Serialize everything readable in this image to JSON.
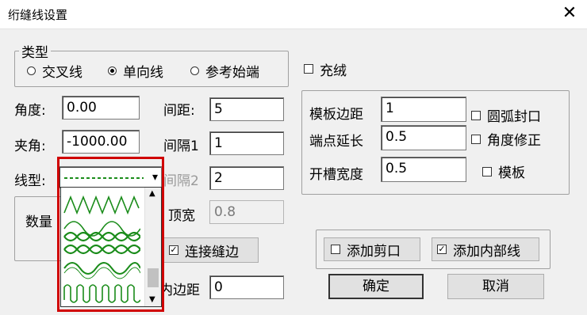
{
  "window": {
    "title": "绗缝线设置",
    "close_symbol": "✕"
  },
  "type_group": {
    "label": "类型",
    "options": [
      {
        "label": "交叉线",
        "selected": false
      },
      {
        "label": "单向线",
        "selected": true
      },
      {
        "label": "参考始端",
        "selected": false
      }
    ]
  },
  "fill_check": {
    "label": "充绒",
    "checked": false
  },
  "angle": {
    "label": "角度:",
    "value": "0.00"
  },
  "pinch_angle": {
    "label": "夹角:",
    "value": "-1000.00"
  },
  "line_type": {
    "label": "线型:",
    "arrow": "▾"
  },
  "spacing": {
    "label": "间距:",
    "value": "5"
  },
  "interval1": {
    "label": "间隔1",
    "value": "1"
  },
  "interval2": {
    "label": "间隔2",
    "value": "2"
  },
  "count": {
    "label": "数量"
  },
  "top_width": {
    "label": "顶宽",
    "value": "0.8"
  },
  "connect_seam": {
    "label": "连接缝边",
    "checked": true
  },
  "inner_margin": {
    "label": "边距",
    "label_prefix": "内",
    "value": "0"
  },
  "template_group": {
    "margin": {
      "label": "模板边距",
      "value": "1"
    },
    "extend": {
      "label": "端点延长",
      "value": "0.5"
    },
    "slot_width": {
      "label": "开槽宽度",
      "value": "0.5"
    },
    "arc_seal": {
      "label": "圆弧封口",
      "checked": false
    },
    "angle_fix": {
      "label": "角度修正",
      "checked": false
    },
    "template": {
      "label": "模板",
      "checked": false
    }
  },
  "add_cut": {
    "label": "添加剪口",
    "checked": false
  },
  "add_inner_line": {
    "label": "添加内部线",
    "checked": true
  },
  "ok_button": {
    "label": "确定"
  },
  "cancel_button": {
    "label": "取消"
  },
  "colors": {
    "stitch_green": "#1a8c1a",
    "highlight_red": "#d00000"
  },
  "scroll": {
    "up_arrow": "▲",
    "down_arrow": "▼",
    "position_fraction": 0.8
  }
}
